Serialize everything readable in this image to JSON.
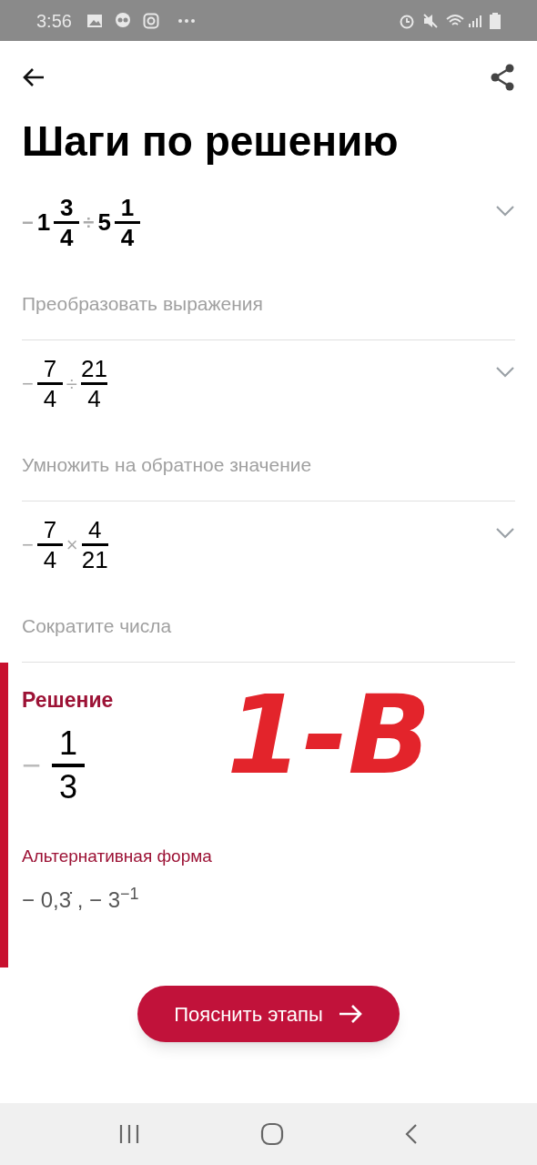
{
  "status_bar": {
    "time": "3:56"
  },
  "title": "Шаги по решению",
  "steps": [
    {
      "expanded": false,
      "bold": true,
      "description": "Преобразовать выражения",
      "expression": [
        {
          "kind": "sign",
          "text": "−"
        },
        {
          "kind": "number",
          "text": "1"
        },
        {
          "kind": "fraction",
          "num": "3",
          "den": "4"
        },
        {
          "kind": "op",
          "text": "÷"
        },
        {
          "kind": "number",
          "text": "5"
        },
        {
          "kind": "fraction",
          "num": "1",
          "den": "4"
        }
      ]
    },
    {
      "expanded": false,
      "bold": false,
      "description": "Умножить на обратное значение",
      "expression": [
        {
          "kind": "sign",
          "text": "−"
        },
        {
          "kind": "fraction",
          "num": "7",
          "den": "4"
        },
        {
          "kind": "op",
          "text": "÷"
        },
        {
          "kind": "fraction",
          "num": "21",
          "den": "4"
        }
      ]
    },
    {
      "expanded": false,
      "bold": false,
      "description": "Сократите числа",
      "expression": [
        {
          "kind": "sign",
          "text": "−"
        },
        {
          "kind": "fraction",
          "num": "7",
          "den": "4"
        },
        {
          "kind": "op",
          "text": "×"
        },
        {
          "kind": "fraction",
          "num": "4",
          "den": "21"
        }
      ]
    }
  ],
  "solution": {
    "heading": "Решение",
    "sign": "−",
    "num": "1",
    "den": "3",
    "alt_heading": "Альтернативная форма",
    "alt_value": "− 0,3̇ , − 3$^{−1}$"
  },
  "annotation": "1-В",
  "button": {
    "label": "Пояснить этапы"
  }
}
